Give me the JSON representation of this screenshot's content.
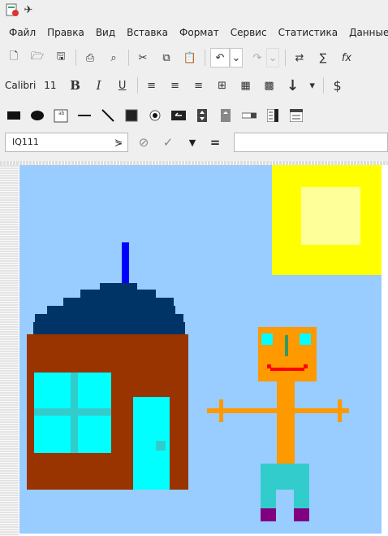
{
  "menu": [
    "Файл",
    "Правка",
    "Вид",
    "Вставка",
    "Формат",
    "Сервис",
    "Статистика",
    "Данные"
  ],
  "font": {
    "name": "Calibri",
    "size": "11"
  },
  "namebox": {
    "value": "IQ111"
  },
  "formula": {
    "equals": "="
  },
  "icons": {
    "title": [
      "app-icon",
      "pin-icon"
    ],
    "standard": [
      "new-icon",
      "open-icon",
      "save-icon",
      "print-icon",
      "print-preview-icon",
      "cut-icon",
      "copy-icon",
      "paste-icon",
      "undo-icon",
      "redo-icon",
      "find-replace-icon",
      "sum-icon",
      "function-icon"
    ],
    "format": [
      "bold-icon",
      "italic-icon",
      "underline-icon",
      "align-left-icon",
      "align-center-icon",
      "align-right-icon",
      "merge-icon",
      "borders-icon",
      "background-icon",
      "sort-icon",
      "currency-icon"
    ],
    "drawing": [
      "rectangle-icon",
      "ellipse-icon",
      "callout-icon",
      "line-icon",
      "arrow-line-icon",
      "square-icon",
      "radio-icon",
      "button-icon",
      "spin-icon",
      "scrollbar-icon",
      "listbox-icon",
      "form-icon"
    ]
  },
  "colors": {
    "sky": "#99ccff",
    "sun": "#ffff00",
    "sun_core": "#ffff99",
    "roof": "#003366",
    "chimney": "#0000ff",
    "house": "#993300",
    "window": "#00ffff",
    "window_frame": "#33cccc",
    "door": "#00ffff",
    "person_head": "#ff9900",
    "person_body": "#ff9900",
    "legs": "#33cccc",
    "shoes": "#800080",
    "eyes": "#00ffff",
    "nose": "#339966",
    "mouth": "#ff0000"
  }
}
